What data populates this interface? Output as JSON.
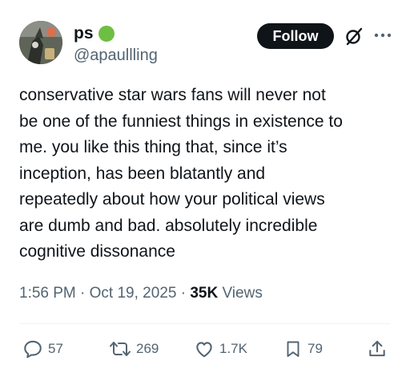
{
  "author": {
    "display_name": "ps",
    "handle": "@apaullling",
    "badge_color": "#6fbe44",
    "avatar_icon": "avatar-image"
  },
  "header": {
    "follow_label": "Follow",
    "grok_icon": "grok-icon",
    "more_icon": "more-dots-icon"
  },
  "tweet": {
    "lines": [
      "conservative star wars fans will never not",
      "be one of the funniest things in existence to",
      "me. you like this thing that, since it’s",
      "inception, has been blatantly and",
      "repeatedly about how your political views",
      "are dumb and bad. absolutely incredible",
      "cognitive dissonance"
    ]
  },
  "meta": {
    "time": "1:56 PM",
    "sep1": " · ",
    "date": "Oct 19, 2025",
    "sep2": " · ",
    "views_count": "35K",
    "views_label": " Views"
  },
  "actions": {
    "replies": "57",
    "reposts": "269",
    "likes": "1.7K",
    "bookmarks": "79",
    "share_icon": "share-icon"
  },
  "colors": {
    "text": "#0f1419",
    "secondary": "#536471",
    "follow_bg": "#0f1419",
    "divider": "#eff3f4"
  }
}
